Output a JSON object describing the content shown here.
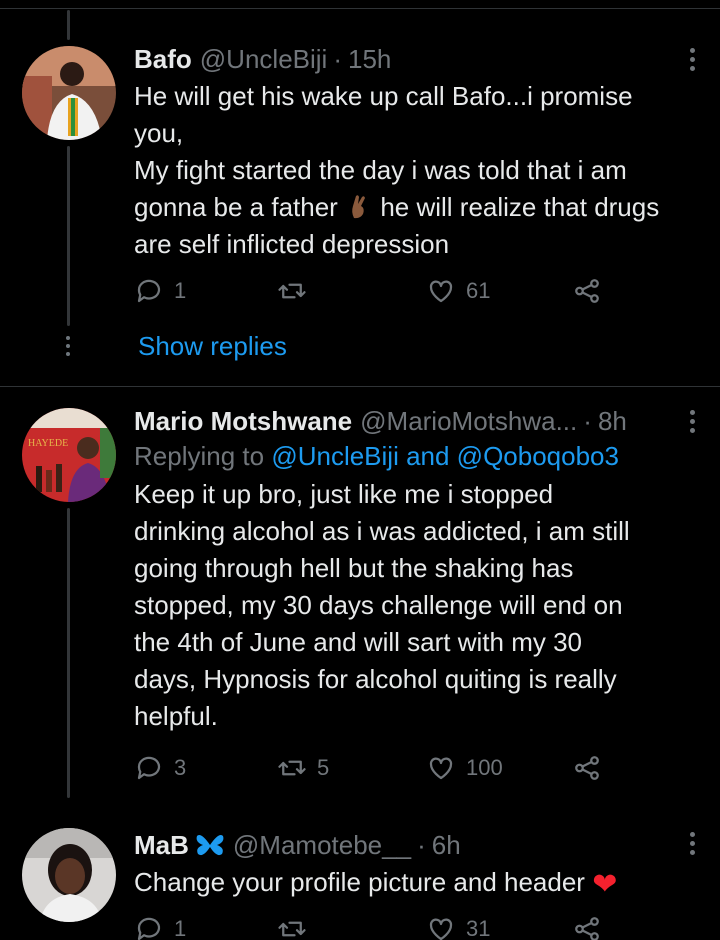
{
  "tweets": [
    {
      "name": "Bafo",
      "handle": "@UncleBiji",
      "time": "15h",
      "text_lines": [
        "He will get his wake up call Bafo...i promise",
        "you,",
        "My fight started the day i was told that i am",
        "gonna be a father",
        "he will realize that drugs",
        "are self inflicted depression"
      ],
      "reply_count": "1",
      "retweet_count": "",
      "like_count": "61",
      "show_replies": "Show replies"
    },
    {
      "name": "Mario Motshwane",
      "handle": "@MarioMotshwa...",
      "time": "8h",
      "replying_prefix": "Replying to",
      "replying_to": "@UncleBiji and @Qoboqobo3",
      "text_lines": [
        "Keep it up bro, just like me i stopped",
        "drinking alcohol as i was addicted, i am still",
        "going through hell but the shaking has",
        "stopped, my 30 days challenge will end on",
        "the 4th of June and will sart with my 30",
        "days, Hypnosis for alcohol quiting is really",
        "helpful."
      ],
      "reply_count": "3",
      "retweet_count": "5",
      "like_count": "100"
    },
    {
      "name": "MaB",
      "handle": "@Mamotebe__",
      "time": "6h",
      "text": "Change your profile picture and header",
      "reply_count": "1",
      "retweet_count": "",
      "like_count": "31"
    }
  ],
  "icons": {
    "reply": "reply-icon",
    "retweet": "retweet-icon",
    "like": "heart-icon",
    "share": "share-icon",
    "more": "more-options-icon",
    "badge": "butterfly-icon",
    "gesture": "crossed-fingers-emoji",
    "heart_emoji": "red-heart-emoji"
  },
  "colors": {
    "background": "#000000",
    "text": "#e7e9ea",
    "muted": "#71767b",
    "accent": "#1d9bf0",
    "heart": "#f4212e"
  }
}
